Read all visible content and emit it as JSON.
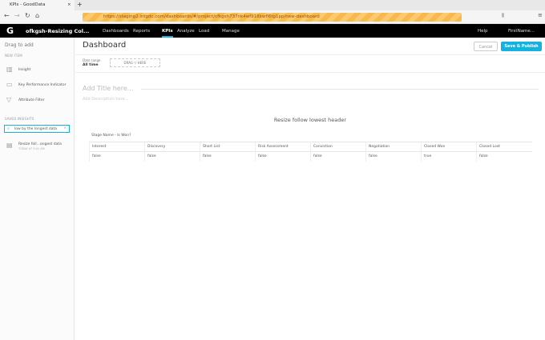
{
  "browser": {
    "tab_title": "KPIs - GoodData",
    "url": "https://staging2.intgdc.com/dashboards/#/project/cfkgsh737nk4wf918kwfl6tg1pp/new-dashboard"
  },
  "app": {
    "project": "ofkgsh-Resizing Col...",
    "nav": [
      "Dashboards",
      "Reports",
      "KPIs",
      "Analyze",
      "Load",
      "Manage"
    ],
    "help": "Help",
    "user": "FirstName..."
  },
  "sidebar": {
    "title": "Drag to add",
    "new_item": "NEW ITEM",
    "items": [
      "Insight",
      "Key Performance Indicator",
      "Attribute Filter"
    ],
    "saved": "SAVED INSIGHTS",
    "search_value": "low by the longest data",
    "insight": {
      "name": "Resize foll...ongest data",
      "date": "TODAY AT 3:41 AM"
    }
  },
  "dashboard": {
    "title": "Dashboard",
    "cancel": "Cancel",
    "save": "Save & Publish",
    "date_label": "Date range",
    "date_value": "All time",
    "drag_here": "DRAG ▽ HERE",
    "title_placeholder": "Add Title here...",
    "desc_placeholder": "Add Description here..."
  },
  "widget": {
    "title": "Resize follow lowest header",
    "attr_label": "Stage Name - Is Won?",
    "headers": [
      "Interest",
      "Discovery",
      "Short List",
      "Risk Assessment",
      "Conviction",
      "Negotiation",
      "Closed Won",
      "Closed Lost"
    ],
    "values": [
      "false",
      "false",
      "false",
      "false",
      "false",
      "false",
      "true",
      "false"
    ]
  },
  "colors": {
    "accent": "#14b2e2"
  }
}
